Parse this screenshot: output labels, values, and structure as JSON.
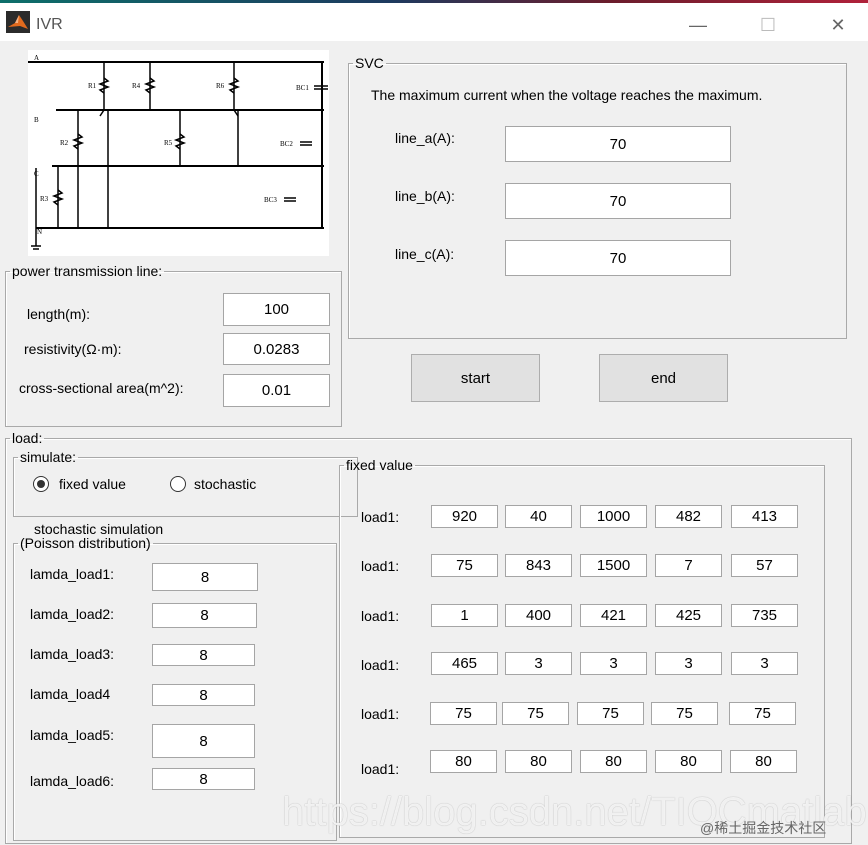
{
  "window": {
    "title": "IVR",
    "minimize": "—",
    "maximize": "☐",
    "close": "✕"
  },
  "circuit": {
    "labels": [
      "A",
      "B",
      "C",
      "N",
      "R1",
      "R4",
      "R6",
      "R2",
      "R5",
      "R3",
      "BC1",
      "BC2",
      "BC3"
    ]
  },
  "power_line": {
    "legend": "power transmission line:",
    "length_label": "length(m):",
    "length_value": "100",
    "resistivity_label": "resistivity(Ω·m):",
    "resistivity_value": "0.0283",
    "area_label": "cross-sectional area(m^2):",
    "area_value": "0.01"
  },
  "svc": {
    "legend": "SVC",
    "description": "The maximum current when the voltage reaches the maximum.",
    "line_a_label": "line_a(A):",
    "line_a_value": "70",
    "line_b_label": "line_b(A):",
    "line_b_value": "70",
    "line_c_label": "line_c(A):",
    "line_c_value": "70"
  },
  "buttons": {
    "start": "start",
    "end": "end"
  },
  "load": {
    "legend": "load:",
    "simulate": {
      "legend": "simulate:",
      "fixed": "fixed value",
      "stochastic": "stochastic",
      "selected": "fixed value"
    },
    "stochastic_sim": {
      "title": "stochastic simulation",
      "legend": "(Poisson distribution)",
      "rows": [
        {
          "label": "lamda_load1:",
          "value": "8"
        },
        {
          "label": "lamda_load2:",
          "value": "8"
        },
        {
          "label": "lamda_load3:",
          "value": "8"
        },
        {
          "label": "lamda_load4",
          "value": "8"
        },
        {
          "label": "lamda_load5:",
          "value": "8"
        },
        {
          "label": "lamda_load6:",
          "value": "8"
        }
      ]
    },
    "fixed": {
      "legend": "fixed value",
      "rows": [
        {
          "label": "load1:",
          "values": [
            "920",
            "40",
            "1000",
            "482",
            "413"
          ]
        },
        {
          "label": "load1:",
          "values": [
            "75",
            "843",
            "1500",
            "7",
            "57"
          ]
        },
        {
          "label": "load1:",
          "values": [
            "1",
            "400",
            "421",
            "425",
            "735"
          ]
        },
        {
          "label": "load1:",
          "values": [
            "465",
            "3",
            "3",
            "3",
            "3"
          ]
        },
        {
          "label": "load1:",
          "values": [
            "75",
            "75",
            "75",
            "75",
            "75"
          ]
        },
        {
          "label": "load1:",
          "values": [
            "80",
            "80",
            "80",
            "80",
            "80"
          ]
        }
      ]
    }
  },
  "watermark": {
    "url": "https://blog.csdn.net/TIQCmatlab",
    "site": "@稀土掘金技术社区"
  }
}
